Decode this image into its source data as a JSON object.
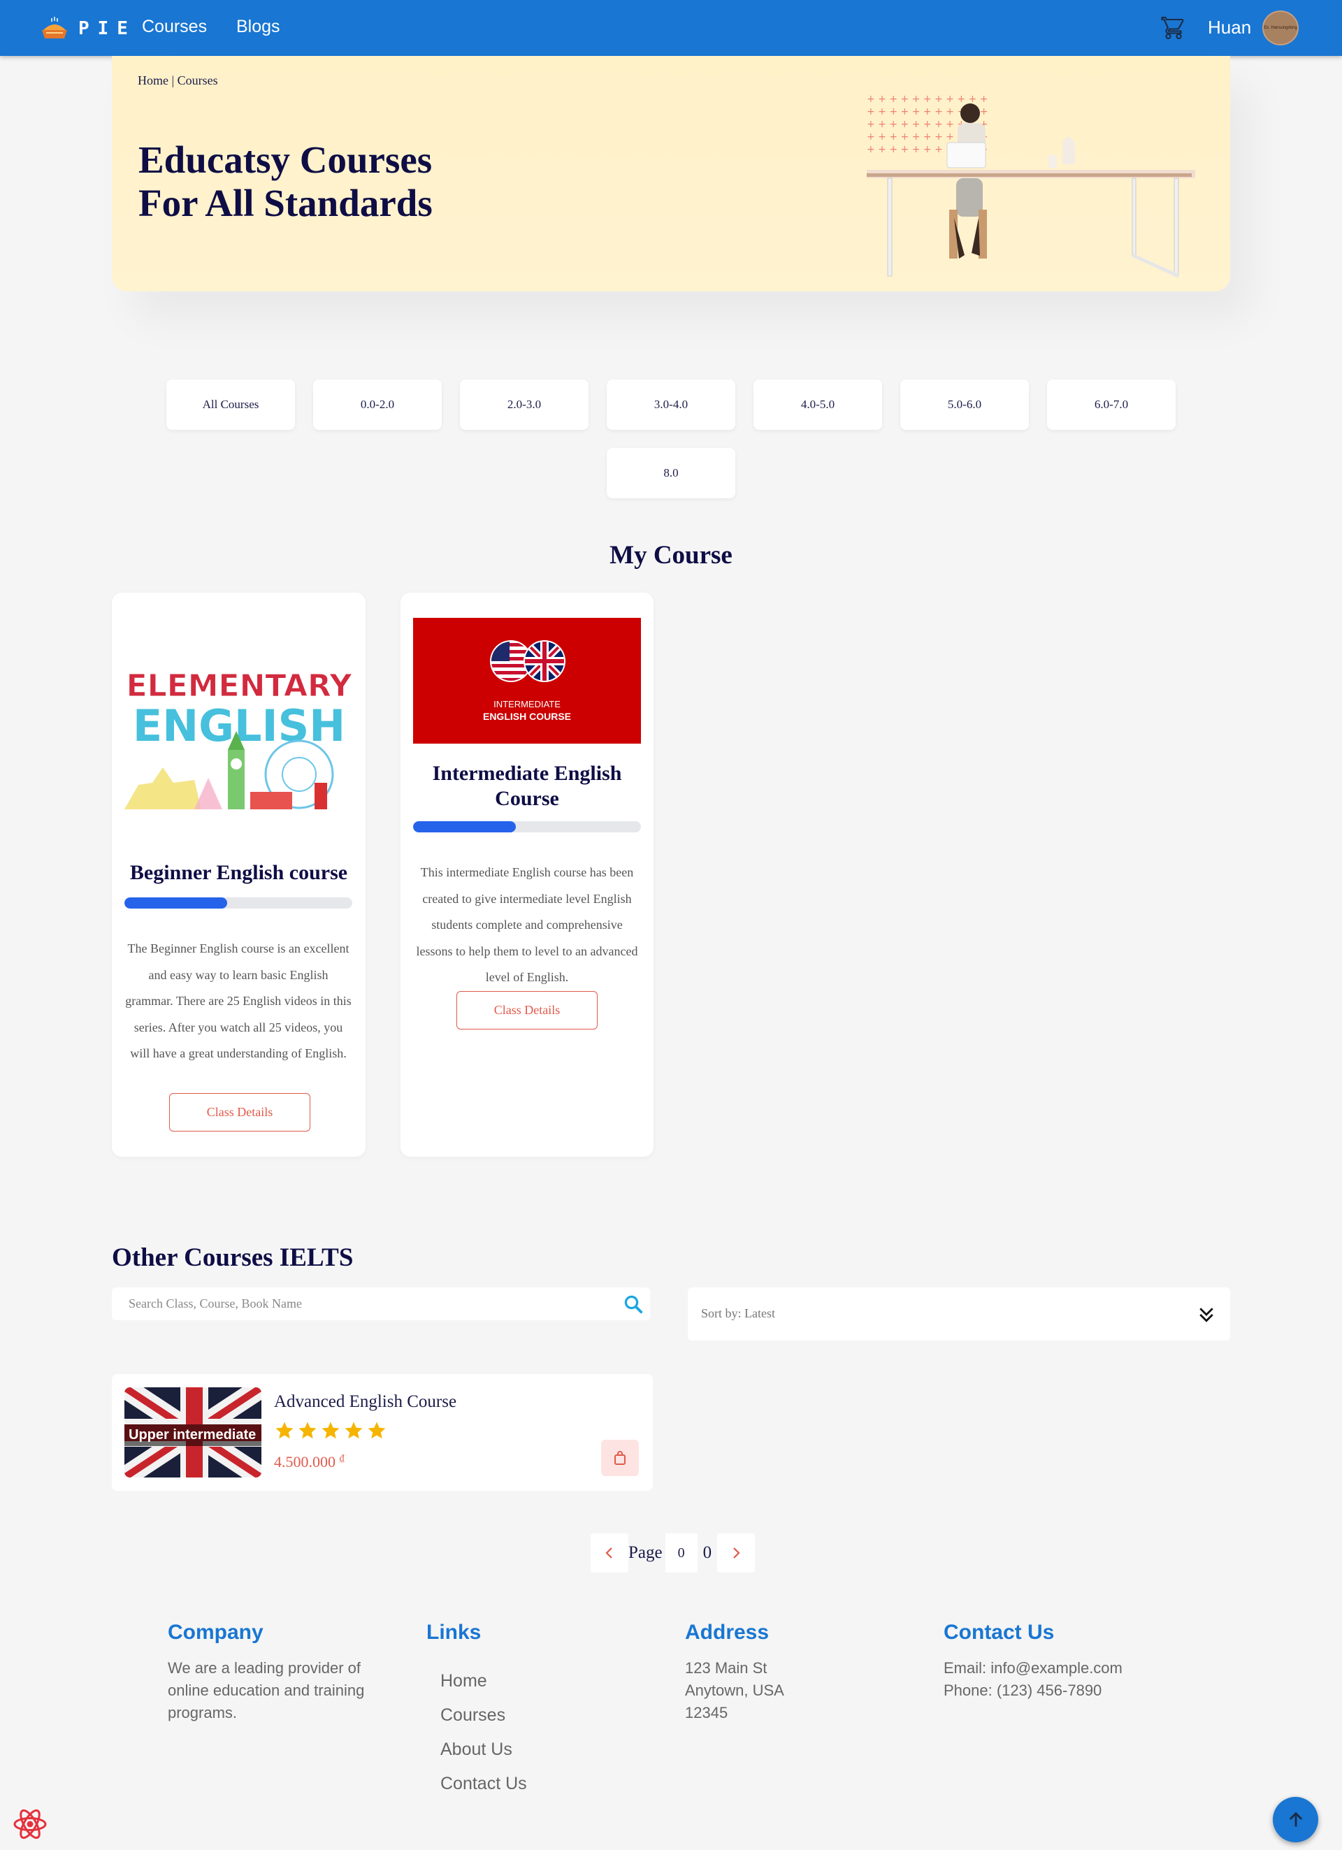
{
  "nav": {
    "logo_text": "PIE",
    "links": [
      "Courses",
      "Blogs"
    ],
    "user_name": "Huan",
    "avatar_text": "Ex. Hansungdong"
  },
  "hero": {
    "breadcrumb": "Home | Courses",
    "title_line1": "Educatsy Courses",
    "title_line2": "For All Standards"
  },
  "filters": [
    "All Courses",
    "0.0-2.0",
    "2.0-3.0",
    "3.0-4.0",
    "4.0-5.0",
    "5.0-6.0",
    "6.0-7.0",
    "8.0"
  ],
  "my_course": {
    "title": "My Course",
    "cards": [
      {
        "image_line1": "ELEMENTARY",
        "image_line2": "ENGLISH",
        "title": "Beginner English course",
        "progress": 0.45,
        "description": "The Beginner English course is an excellent and easy way to learn basic English grammar. There are 25 English videos in this series. After you watch all 25 videos, you will have a great understanding of English.",
        "button": "Class Details"
      },
      {
        "image_line1": "INTERMEDIATE",
        "image_line2": "ENGLISH COURSE",
        "title": "Intermediate English Course",
        "progress": 0.45,
        "description": "This intermediate English course has been created to give intermediate level English students complete and comprehensive lessons to help them to level to an advanced level of English.",
        "button": "Class Details"
      }
    ]
  },
  "other": {
    "title": "Other Courses IELTS",
    "search_placeholder": "Search Class, Course, Book Name",
    "sort_label": "Sort by: Latest",
    "items": [
      {
        "thumb_text": "Upper intermediate",
        "title": "Advanced English Course",
        "rating": 5,
        "price": "4.500.000",
        "currency": "₫"
      }
    ]
  },
  "pagination": {
    "label": "Page",
    "current": "0",
    "total": "0"
  },
  "footer": {
    "company": {
      "heading": "Company",
      "text": "We are a leading provider of online education and training programs."
    },
    "links": {
      "heading": "Links",
      "items": [
        "Home",
        "Courses",
        "About Us",
        "Contact Us"
      ]
    },
    "address": {
      "heading": "Address",
      "line1": "123 Main St",
      "line2": "Anytown, USA",
      "line3": "12345"
    },
    "contact": {
      "heading": "Contact Us",
      "email": "Email: info@example.com",
      "phone": "Phone: (123) 456-7890"
    }
  },
  "colors": {
    "primary": "#1976d2",
    "accent": "#e05a4a",
    "hero_bg": "#fff1c8",
    "progress": "#2563eb",
    "heading": "#0e0d45",
    "star": "#f5b400"
  },
  "icons": {
    "cart": "cart-icon",
    "search": "search-icon",
    "sort": "chevron-double-down-icon",
    "back_to_top": "arrow-up-icon",
    "react": "react-icon"
  }
}
